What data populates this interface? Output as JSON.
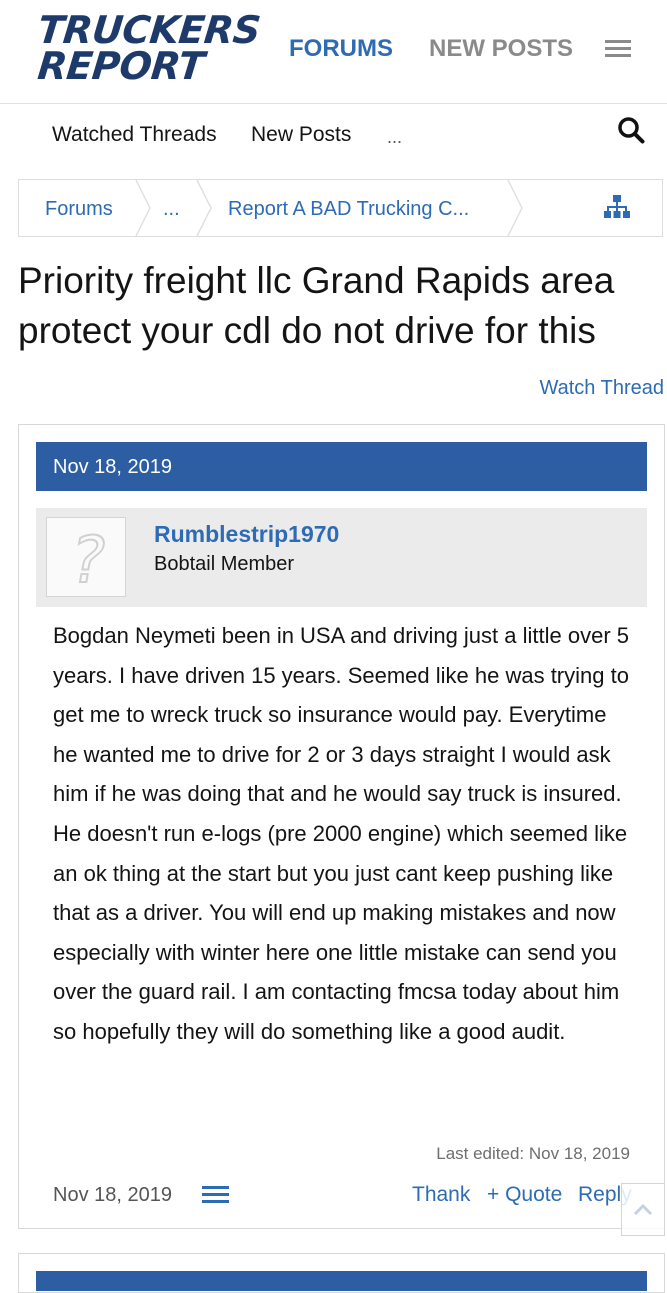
{
  "header": {
    "logo_line1": "TRUCKERS",
    "logo_line2": "REPORT",
    "nav_forums": "FORUMS",
    "nav_new_posts": "NEW POSTS",
    "menu_icon": "hamburger-icon"
  },
  "subnav": {
    "watched_threads": "Watched Threads",
    "new_posts": "New Posts",
    "more": "...",
    "search_icon": "search-icon"
  },
  "breadcrumb": {
    "items": [
      "Forums",
      "...",
      "Report A BAD Trucking C..."
    ],
    "sitemap_icon": "sitemap-icon"
  },
  "thread": {
    "title": "Priority freight llc Grand Rapids area protect your cdl do not drive for this",
    "watch": "Watch Thread"
  },
  "post": {
    "date": "Nov 18, 2019",
    "username": "Rumblestrip1970",
    "user_title": "Bobtail Member",
    "body": "Bogdan Neymeti been in USA and driving just a little over 5 years. I have driven 15 years. Seemed like he was trying to get me to wreck truck so insurance would pay. Everytime he wanted me to drive for 2 or 3 days straight I would ask him if he was doing that and he would say truck is insured. He doesn't run e-logs (pre 2000 engine) which seemed like an ok thing at the start but you just cant keep pushing like that as a driver. You will end up making mistakes and now especially with winter here one little mistake can send you over the guard rail. I am contacting fmcsa today about him so hopefully they will do something like a good audit.",
    "last_edited": "Last edited: Nov 18, 2019",
    "footer_date": "Nov 18, 2019",
    "actions": {
      "thank": "Thank",
      "quote": "+ Quote",
      "reply": "Reply"
    }
  },
  "colors": {
    "brand_navy": "#1d3a6b",
    "link_blue": "#2d6bb5",
    "date_bar": "#2d5ea3"
  }
}
